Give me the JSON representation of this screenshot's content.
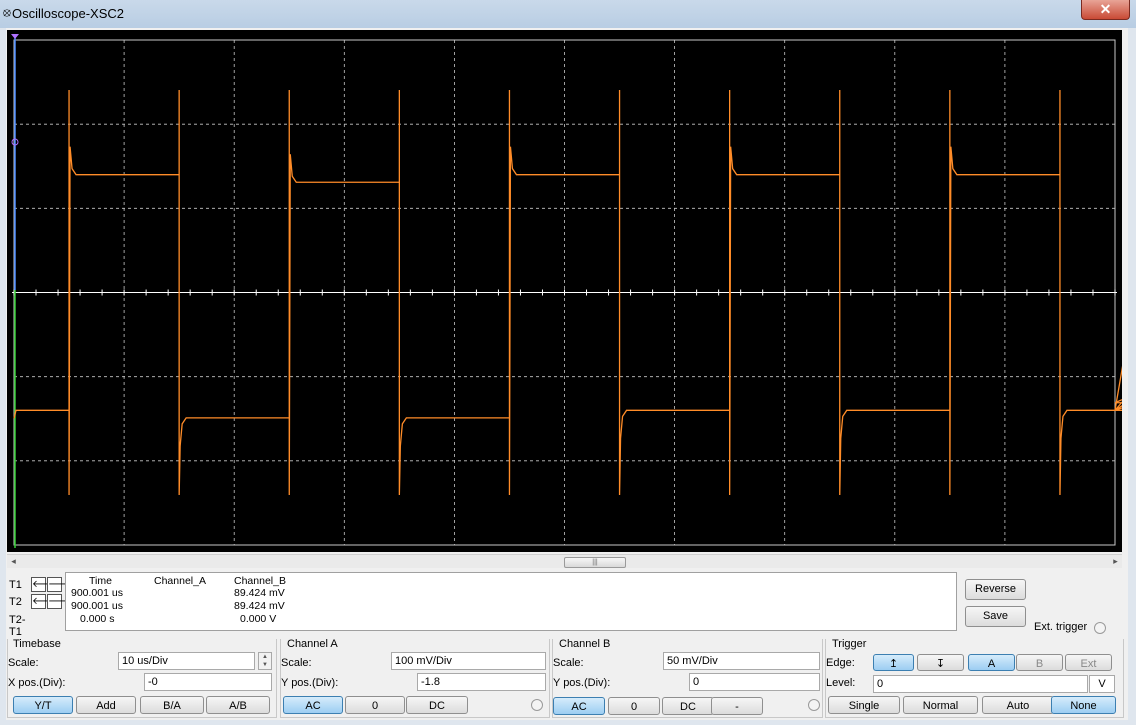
{
  "window": {
    "title": "Oscilloscope-XSC2",
    "close_label": "✕"
  },
  "colors": {
    "trace": "#ff8c28",
    "screen_bg": "#000000",
    "grid": "#c8c8c8",
    "axis_a": "#4c8cff",
    "axis_b": "#33cc33"
  },
  "scrollbar": {
    "left_arrow": "◂",
    "right_arrow": "▸",
    "thumb": "|||"
  },
  "cursors": [
    {
      "label": "T1",
      "left": "🡐",
      "right": "🡒"
    },
    {
      "label": "T2",
      "left": "🡐",
      "right": "🡒"
    },
    {
      "label": "T2-T1"
    }
  ],
  "readout": {
    "headers": {
      "time": "Time",
      "channel_a": "Channel_A",
      "channel_b": "Channel_B"
    },
    "rows": [
      {
        "time": "900.001 us",
        "channel_a": "",
        "channel_b": "89.424 mV"
      },
      {
        "time": "900.001 us",
        "channel_a": "",
        "channel_b": "89.424 mV"
      },
      {
        "time": "0.000 s",
        "channel_a": "",
        "channel_b": "0.000 V"
      }
    ]
  },
  "buttons": {
    "reverse": "Reverse",
    "save": "Save",
    "ext_trigger": "Ext. trigger"
  },
  "timebase": {
    "title": "Timebase",
    "scale_label": "Scale:",
    "scale_value": "10 us/Div",
    "xpos_label": "X pos.(Div):",
    "xpos_value": "-0",
    "modes": [
      "Y/T",
      "Add",
      "B/A",
      "A/B"
    ],
    "active_mode": "Y/T"
  },
  "channel_a": {
    "title": "Channel A",
    "scale_label": "Scale:",
    "scale_value": "100 mV/Div",
    "ypos_label": "Y pos.(Div):",
    "ypos_value": "-1.8",
    "coupling": [
      "AC",
      "0",
      "DC"
    ],
    "active_coupling": "AC"
  },
  "channel_b": {
    "title": "Channel B",
    "scale_label": "Scale:",
    "scale_value": "50 mV/Div",
    "ypos_label": "Y pos.(Div):",
    "ypos_value": "0",
    "coupling": [
      "AC",
      "0",
      "DC",
      "-"
    ],
    "active_coupling": "AC"
  },
  "trigger": {
    "title": "Trigger",
    "edge_label": "Edge:",
    "edge_rising": "↥",
    "edge_falling": "↧",
    "sources": [
      "A",
      "B",
      "Ext"
    ],
    "active_source": "A",
    "level_label": "Level:",
    "level_value": "0",
    "level_unit": "V",
    "modes": [
      "Single",
      "Normal",
      "Auto",
      "None"
    ],
    "active_mode": "None"
  },
  "chart_data": {
    "type": "line",
    "x_unit": "us",
    "time_per_div_us": 10,
    "x_divisions": 10,
    "y_divisions": 6,
    "grid": true,
    "series": [
      {
        "channel": "A",
        "scale_mV_per_div": 100,
        "y_position_div": -1.8,
        "shape": "square wave with overshoot, period ~20us",
        "high_div": [
          1.4,
          1.31,
          1.4,
          1.4,
          1.4,
          1.4,
          1.4,
          1.49,
          1.49,
          1.4
        ],
        "low_div": [
          -1.4,
          -1.49,
          -1.49,
          -1.4,
          -1.4,
          -1.4,
          -1.4,
          -1.4,
          -1.31,
          -1.4
        ]
      }
    ]
  }
}
